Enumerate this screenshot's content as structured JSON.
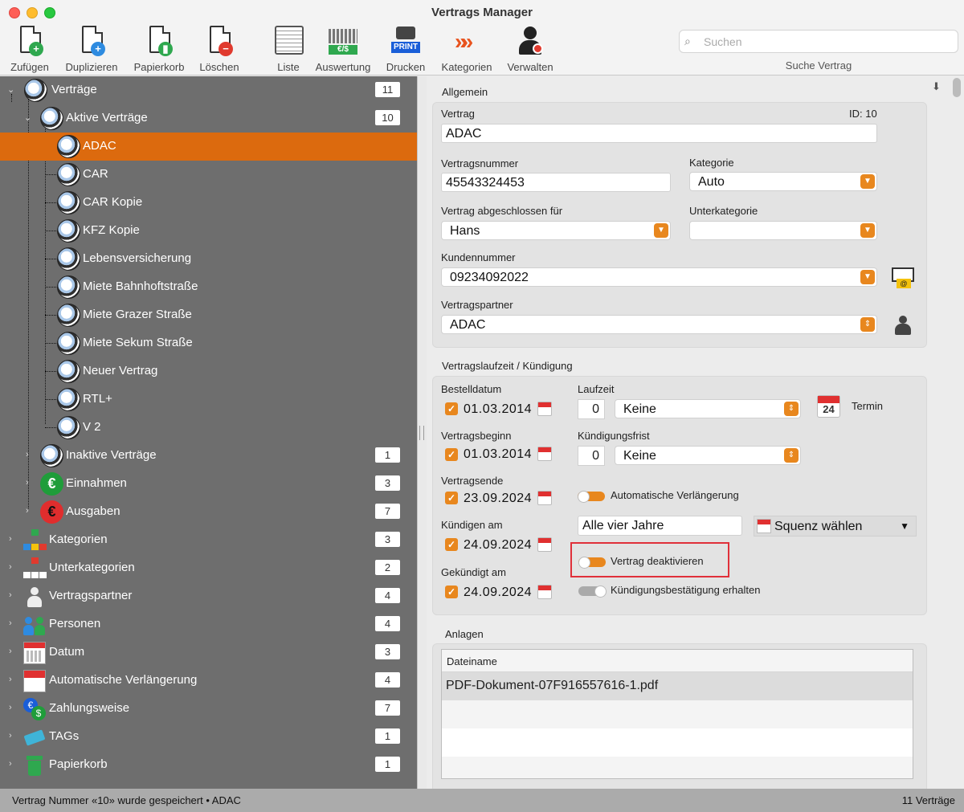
{
  "window": {
    "title": "Vertrags Manager"
  },
  "toolbar": {
    "add": "Zufügen",
    "duplicate": "Duplizieren",
    "trash": "Papierkorb",
    "delete": "Löschen",
    "list": "Liste",
    "evaluation": "Auswertung",
    "print": "Drucken",
    "print_badge": "PRINT",
    "categories": "Kategorien",
    "manage": "Verwalten",
    "eval_badge": "€/$"
  },
  "search": {
    "placeholder": "Suchen",
    "caption": "Suche Vertrag"
  },
  "sidebar": {
    "items": [
      {
        "label": "Verträge",
        "count": "11"
      },
      {
        "label": "Aktive Verträge",
        "count": "10"
      },
      {
        "label": "ADAC"
      },
      {
        "label": "CAR"
      },
      {
        "label": "CAR Kopie"
      },
      {
        "label": "KFZ Kopie"
      },
      {
        "label": "Lebensversicherung"
      },
      {
        "label": "Miete Bahnhoftstraße"
      },
      {
        "label": "Miete Grazer Straße"
      },
      {
        "label": "Miete Sekum Straße"
      },
      {
        "label": "Neuer Vertrag"
      },
      {
        "label": "RTL+"
      },
      {
        "label": "V 2"
      },
      {
        "label": "Inaktive Verträge",
        "count": "1"
      },
      {
        "label": "Einnahmen",
        "count": "3"
      },
      {
        "label": "Ausgaben",
        "count": "7"
      },
      {
        "label": "Kategorien",
        "count": "3"
      },
      {
        "label": "Unterkategorien",
        "count": "2"
      },
      {
        "label": "Vertragspartner",
        "count": "4"
      },
      {
        "label": "Personen",
        "count": "4"
      },
      {
        "label": "Datum",
        "count": "3"
      },
      {
        "label": "Automatische Verlängerung",
        "count": "4"
      },
      {
        "label": "Zahlungsweise",
        "count": "7"
      },
      {
        "label": "TAGs",
        "count": "1"
      },
      {
        "label": "Papierkorb",
        "count": "1"
      }
    ]
  },
  "general": {
    "section_title": "Allgemein",
    "contract_label": "Vertrag",
    "contract_value": "ADAC",
    "id_label": "ID: 10",
    "number_label": "Vertragsnummer",
    "number_value": "45543324453",
    "category_label": "Kategorie",
    "category_value": "Auto",
    "concluded_for_label": "Vertrag abgeschlossen für",
    "concluded_for_value": "Hans",
    "subcategory_label": "Unterkategorie",
    "subcategory_value": "",
    "customer_no_label": "Kundennummer",
    "customer_no_value": "09234092022",
    "partner_label": "Vertragspartner",
    "partner_value": "ADAC"
  },
  "term": {
    "section_title": "Vertragslaufzeit / Kündigung",
    "order_date_label": "Bestelldatum",
    "order_date": "01.03.2014",
    "runtime_label": "Laufzeit",
    "runtime_num": "0",
    "runtime_unit": "Keine",
    "termin_label": "Termin",
    "termin_day": "24",
    "start_label": "Vertragsbeginn",
    "start_date": "01.03.2014",
    "notice_label": "Kündigungsfrist",
    "notice_num": "0",
    "notice_unit": "Keine",
    "end_label": "Vertragsende",
    "end_date": "23.09.2024",
    "auto_renew_label": "Automatische Verlängerung",
    "cancel_on_label": "Kündigen am",
    "cancel_on_date": "24.09.2024",
    "repeat_value": "Alle vier Jahre",
    "sequence_label": "Squenz wählen",
    "deactivate_label": "Vertrag deaktivieren",
    "cancelled_label": "Gekündigt am",
    "cancelled_date": "24.09.2024",
    "confirmation_label": "Kündigungsbestätigung erhalten"
  },
  "attachments": {
    "section_title": "Anlagen",
    "column": "Dateiname",
    "files": [
      "PDF-Dokument-07F916557616-1.pdf"
    ]
  },
  "status": {
    "left": "Vertrag Nummer «10» wurde gespeichert • ADAC",
    "right": "11 Verträge"
  },
  "colors": {
    "accent": "#dc6a0e",
    "sidebar_bg": "#6e6e6e",
    "highlight_border": "#e0303a"
  },
  "icons": [
    "add-doc-icon",
    "duplicate-doc-icon",
    "trash-doc-icon",
    "delete-doc-icon",
    "list-icon",
    "evaluation-icon",
    "printer-icon",
    "categories-icon",
    "manage-icon",
    "search-icon",
    "globe-icon",
    "euro-icon",
    "calendar-icon",
    "mail-icon",
    "people-icon",
    "tag-icon",
    "trash-icon"
  ]
}
